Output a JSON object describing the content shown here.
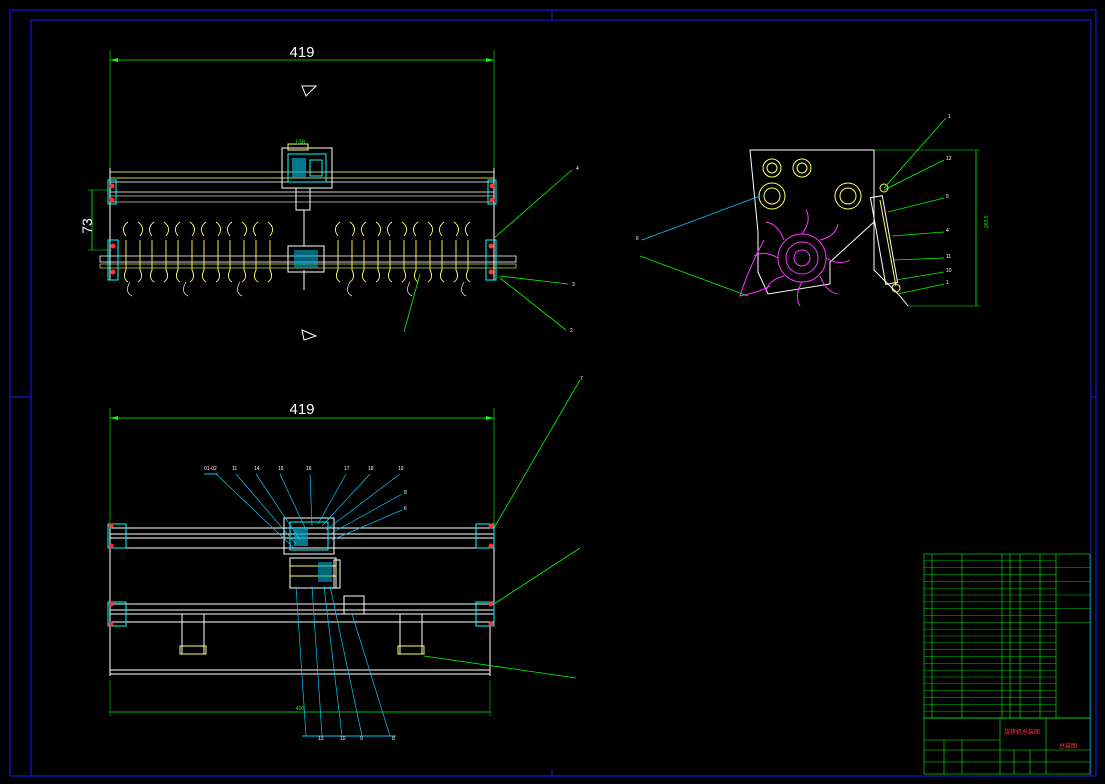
{
  "drawing": {
    "dim_top_width": "419",
    "dim_top_height": "73",
    "dim_top_small": "138",
    "dim_bottom_width": "419",
    "dim_bottom_inner": "400",
    "side_dim_height": "263.5"
  },
  "leaders": {
    "top_view": [
      "4",
      "3",
      "2"
    ],
    "side_view_right": [
      "1",
      "12",
      "5",
      "4",
      "11",
      "10",
      "1"
    ],
    "side_view_left": "6",
    "front_view_top": [
      "01-02",
      "11",
      "14",
      "15",
      "16",
      "17",
      "18",
      "19"
    ],
    "front_view_right": [
      "8",
      "6"
    ],
    "front_view_bottom": [
      "13",
      "10",
      "9",
      "8",
      "7"
    ]
  },
  "title_block": {
    "drawing_name": "旋耕机总装图",
    "drawing_no": "总装图"
  },
  "colors": {
    "frame": "#1a1aff",
    "dimension": "#00ff00",
    "part_outline": "#ffffff",
    "tines": "#ffff66",
    "gearbox": "#00ffff",
    "rotor": "#ff00ff",
    "flange": "#ff3333",
    "title_text": "#ff3333"
  }
}
